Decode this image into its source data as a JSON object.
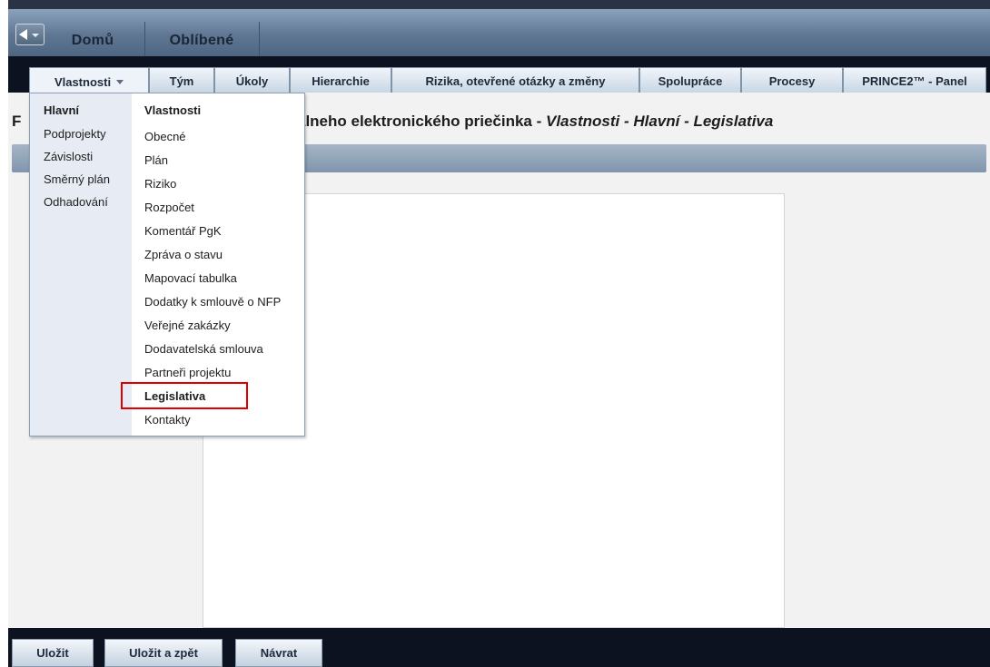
{
  "topbar": {
    "home_label": "Domů",
    "favorites_label": "Oblíbené"
  },
  "tabs": [
    {
      "label": "Vlastnosti"
    },
    {
      "label": "Tým"
    },
    {
      "label": "Úkoly"
    },
    {
      "label": "Hierarchie"
    },
    {
      "label": "Rizika, otevřené otázky a změny"
    },
    {
      "label": "Spolupráce"
    },
    {
      "label": "Procesy"
    },
    {
      "label": "PRINCE2™ - Panel"
    }
  ],
  "page": {
    "title_prefix": "F",
    "title_visible": "álneho elektronického priečinka - ",
    "title_italic": "Vlastnosti - Hlavní - Legislativa"
  },
  "menu": {
    "left_header": "Hlavní",
    "left_items": [
      "Podprojekty",
      "Závislosti",
      "Směrný plán",
      "Odhadování"
    ],
    "right_header": "Vlastnosti",
    "right_items": [
      "Obecné",
      "Plán",
      "Riziko",
      "Rozpočet",
      "Komentář PgK",
      "Zpráva o stavu",
      "Mapovací tabulka",
      "Dodatky k smlouvě o NFP",
      "Veřejné zakázky",
      "Dodavatelská smlouva",
      "Partneři projektu",
      "Legislativa",
      "Kontakty"
    ],
    "selected_item": "Legislativa"
  },
  "footer": {
    "save_label": "Uložit",
    "save_back_label": "Uložit a zpět",
    "return_label": "Návrat"
  },
  "colors": {
    "highlight_box": "#e10000",
    "tab_bar_bg": "#0d1220"
  }
}
